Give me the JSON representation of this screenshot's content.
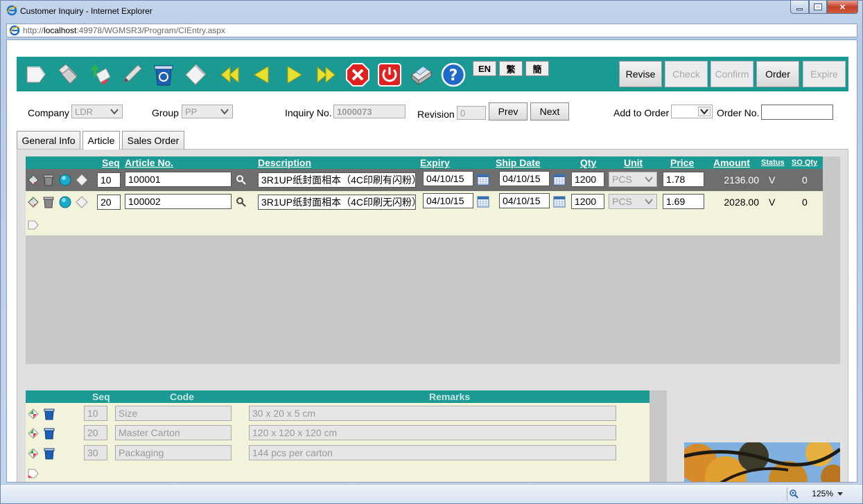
{
  "window": {
    "title": "Customer Inquiry - Internet Explorer"
  },
  "address": {
    "prefix": "http://",
    "host": "localhost",
    "rest": ":49978/WGMSR3/Program/CIEntry.aspx"
  },
  "toolbar": {
    "lang": [
      "EN",
      "繁",
      "簡"
    ],
    "buttons": {
      "revise": "Revise",
      "check": "Check",
      "confirm": "Confirm",
      "order": "Order",
      "expire": "Expire"
    }
  },
  "form": {
    "company_label": "Company",
    "company_value": "LDR",
    "group_label": "Group",
    "group_value": "PP",
    "inquiry_label": "Inquiry No.",
    "inquiry_value": "1000073",
    "revision_label": "Revision",
    "revision_value": "0",
    "prev": "Prev",
    "next": "Next",
    "add_to_order_label": "Add to Order",
    "order_no_label": "Order No.",
    "order_no_value": ""
  },
  "tabs": [
    "General Info",
    "Article",
    "Sales Order"
  ],
  "articles": {
    "headers": {
      "seq": "Seq",
      "article": "Article No.",
      "desc": "Description",
      "expiry": "Expiry",
      "ship": "Ship Date",
      "qty": "Qty",
      "unit": "Unit",
      "price": "Price",
      "amount": "Amount",
      "status": "Status",
      "soqty": "SO Qty"
    },
    "rows": [
      {
        "seq": "10",
        "article": "100001",
        "desc": "3R1UP纸封面相本（4C印刷有闪粉）",
        "expiry": "04/10/15",
        "ship": "04/10/15",
        "qty": "1200",
        "unit": "PCS",
        "price": "1.78",
        "amount": "2136.00",
        "status": "V",
        "soqty": "0"
      },
      {
        "seq": "20",
        "article": "100002",
        "desc": "3R1UP纸封面相本（4C印刷无闪粉）",
        "expiry": "04/10/15",
        "ship": "04/10/15",
        "qty": "1200",
        "unit": "PCS",
        "price": "1.69",
        "amount": "2028.00",
        "status": "V",
        "soqty": "0"
      }
    ]
  },
  "remarks": {
    "headers": {
      "seq": "Seq",
      "code": "Code",
      "remarks": "Remarks"
    },
    "rows": [
      {
        "seq": "10",
        "code": "Size",
        "remarks": "30 x 20 x 5 cm"
      },
      {
        "seq": "20",
        "code": "Master Carton",
        "remarks": "120 x 120 x 120 cm"
      },
      {
        "seq": "30",
        "code": "Packaging",
        "remarks": "144 pcs per carton"
      }
    ]
  },
  "status_bar": {
    "zoom": "125%"
  }
}
